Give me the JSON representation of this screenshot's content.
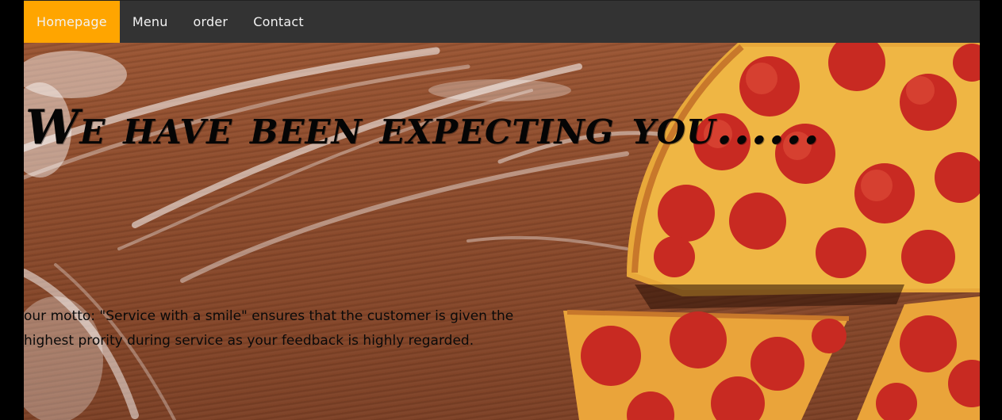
{
  "nav": {
    "items": [
      {
        "label": "Homepage",
        "active": true
      },
      {
        "label": "Menu",
        "active": false
      },
      {
        "label": "order",
        "active": false
      },
      {
        "label": "Contact",
        "active": false
      }
    ],
    "active_color": "#ffa500",
    "bar_color": "#333333"
  },
  "hero": {
    "headline": "We have been expecting you......",
    "motto": "our motto: \"Service with a smile\" ensures that the customer is given the highest prority during service as your feedback is highly regarded.",
    "background_image": "pizza-on-floured-wooden-table"
  }
}
